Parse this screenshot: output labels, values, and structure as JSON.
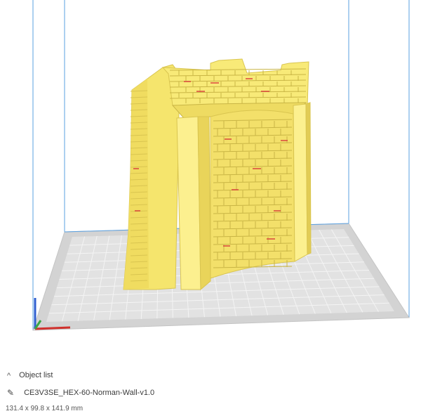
{
  "viewport": {
    "colors": {
      "background": "#ffffff",
      "build_volume_lines": "#5aa0e0",
      "plate_fill": "#d9d9d9",
      "plate_grid": "#f3f3f3",
      "plate_border": "#c4c4c4",
      "model_main": "#f5e56d",
      "model_light": "#fcf08f",
      "model_shadow": "#d9c550",
      "model_mortar": "#c9b545",
      "overhang": "#d83a3a",
      "axis_x": "#d0312d",
      "axis_y": "#3aa845",
      "axis_z": "#2f5fd0"
    }
  },
  "object_list": {
    "header_icon": "chevron-up-icon",
    "header_label": "Object list",
    "edit_icon": "pencil-icon",
    "file_name": "CE3V3SE_HEX-60-Norman-Wall-v1.0",
    "dimensions": "131.4 x 99.8 x 141.9 mm"
  }
}
